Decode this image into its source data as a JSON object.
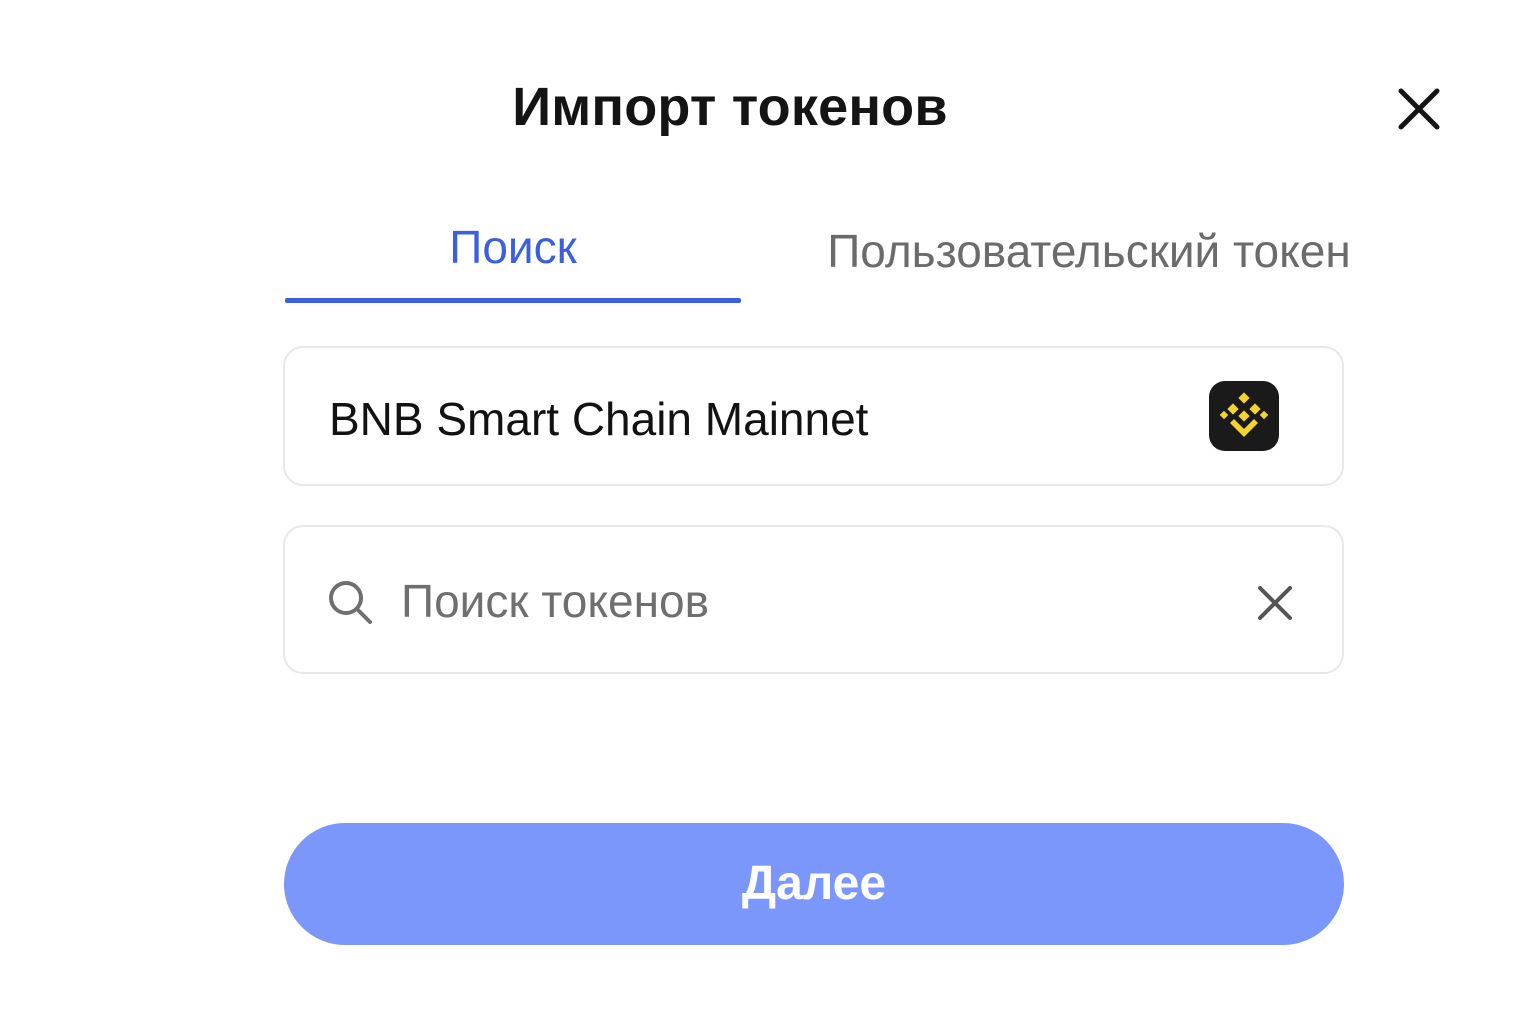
{
  "dialog": {
    "title": "Импорт токенов",
    "close_icon": "close-icon"
  },
  "tabs": [
    {
      "label": "Поиск",
      "active": true
    },
    {
      "label": "Пользовательский токен",
      "active": false
    }
  ],
  "network": {
    "name": "BNB Smart Chain Mainnet",
    "logo_icon": "bnb-chain-logo-icon"
  },
  "search": {
    "value": "",
    "placeholder": "Поиск токенов",
    "icon": "search-icon",
    "clear_icon": "clear-icon"
  },
  "footer": {
    "next_label": "Далее"
  },
  "colors": {
    "accent": "#3c5fe0",
    "button": "#7b97fc",
    "bnb_yellow": "#f3d232"
  }
}
